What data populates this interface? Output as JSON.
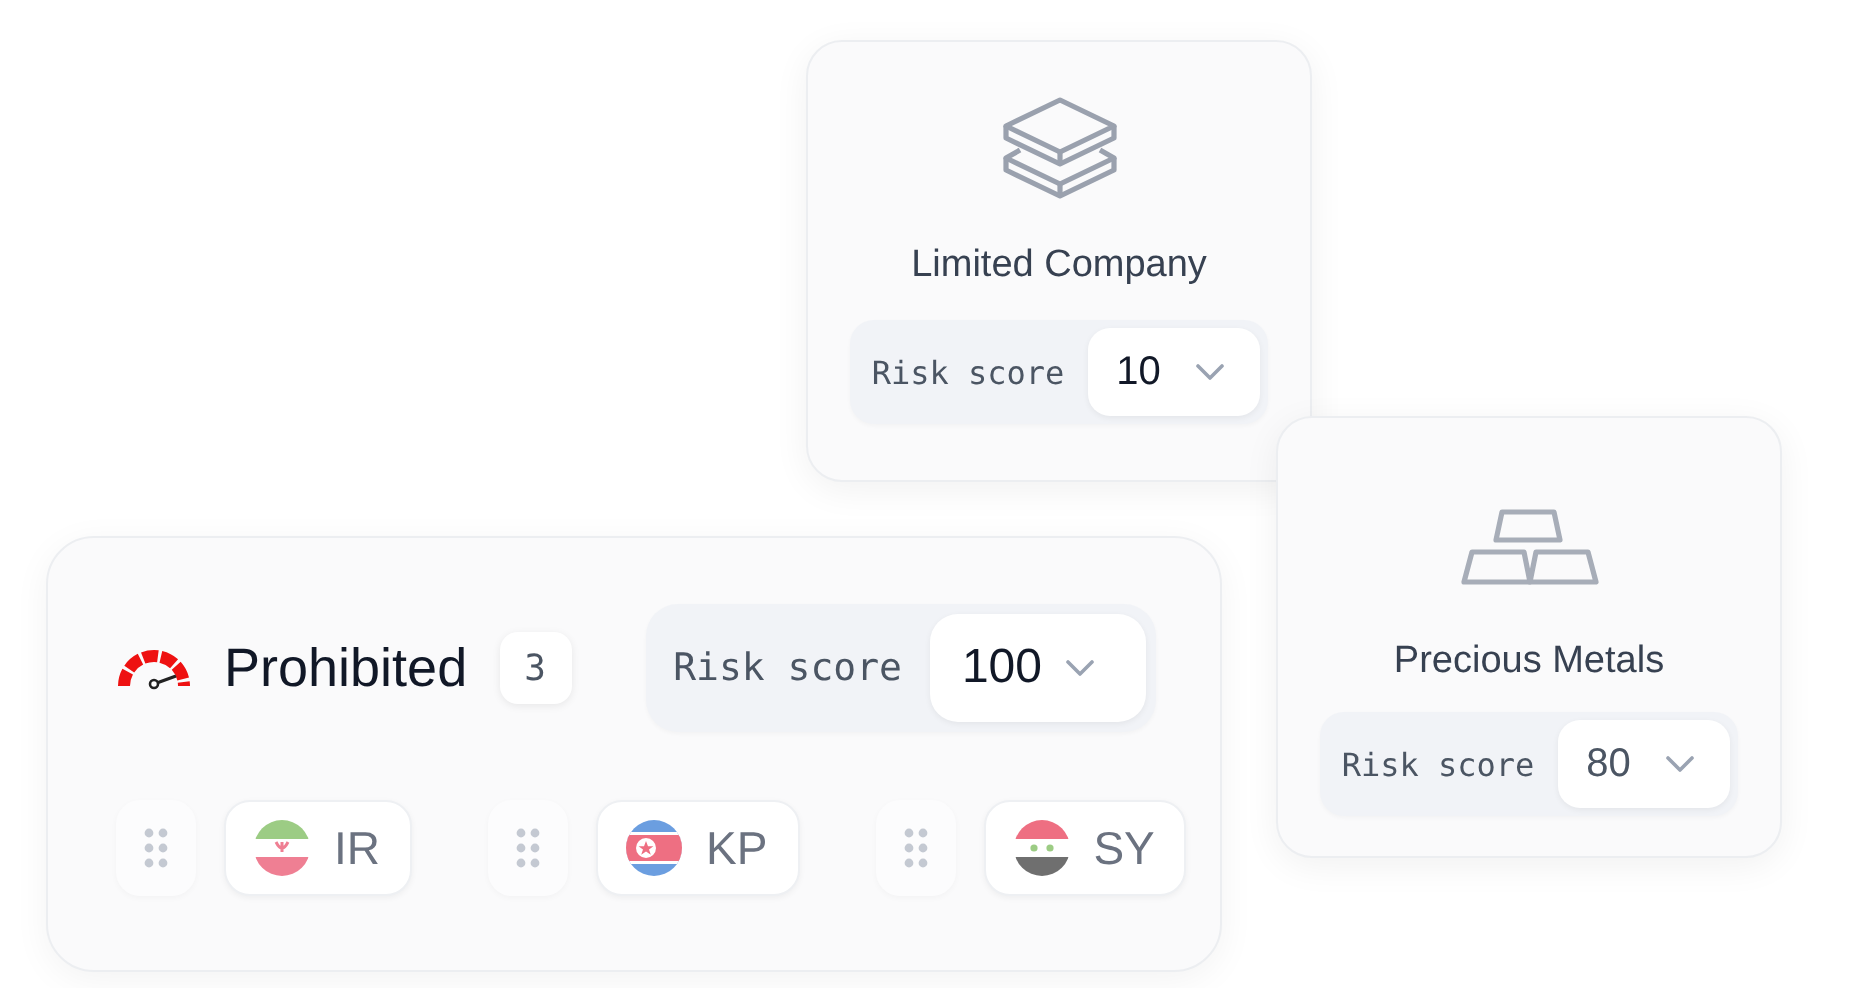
{
  "cards": [
    {
      "title": "Limited Company",
      "risk_label": "Risk score",
      "risk_value": "10"
    },
    {
      "title": "Precious Metals",
      "risk_label": "Risk score",
      "risk_value": "80"
    }
  ],
  "prohibited": {
    "title": "Prohibited",
    "count": "3",
    "risk_label": "Risk score",
    "risk_value": "100",
    "countries": [
      {
        "code": "IR"
      },
      {
        "code": "KP"
      },
      {
        "code": "SY"
      }
    ]
  }
}
